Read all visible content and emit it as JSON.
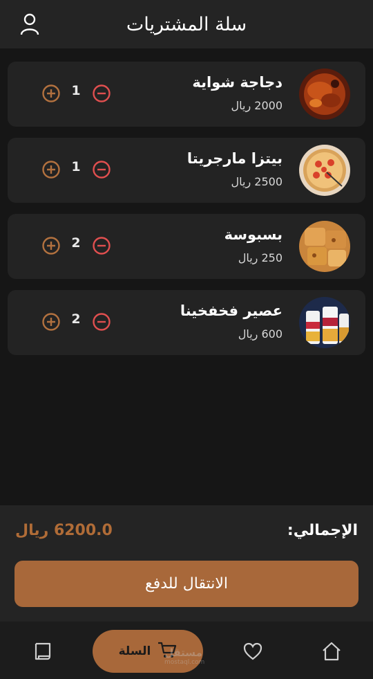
{
  "header": {
    "title": "سلة المشتريات",
    "profile_icon": "user-icon"
  },
  "items": [
    {
      "name": "دجاجة شواية",
      "price": "2000 ريال",
      "qty": "1",
      "image": "roast-chicken"
    },
    {
      "name": "بيتزا مارجريتا",
      "price": "2500 ريال",
      "qty": "1",
      "image": "margherita-pizza"
    },
    {
      "name": "بسبوسة",
      "price": "250 ريال",
      "qty": "2",
      "image": "basbousa"
    },
    {
      "name": "عصير فخفخينا",
      "price": "600 ريال",
      "qty": "2",
      "image": "fakhfakhina-juice"
    }
  ],
  "summary": {
    "total_label": "الإجمالي:",
    "total_value": "6200.0 ريال",
    "checkout_label": "الانتقال للدفع"
  },
  "nav": {
    "cart_label": "السلة",
    "items": [
      "home-icon",
      "heart-icon",
      "cart-icon",
      "receipt-icon"
    ]
  },
  "watermark": {
    "brand": "مستقل",
    "site": "mostaql.com"
  },
  "colors": {
    "accent": "#a8683a",
    "accent_text": "#b06c37",
    "plus": "#b2713f",
    "minus": "#e04f4f",
    "card": "#232323",
    "background": "#161616"
  }
}
